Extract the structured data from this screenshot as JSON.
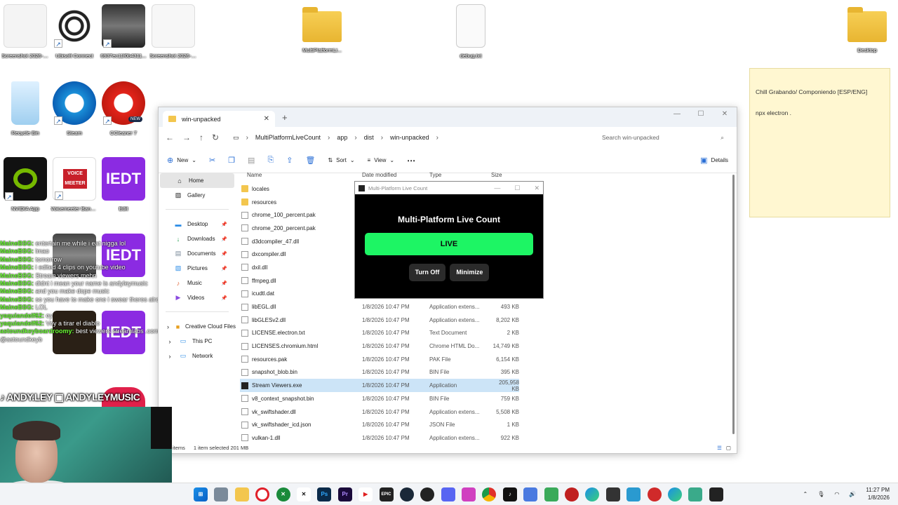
{
  "desktop": {
    "icons": [
      {
        "label": "Screenshot 2026-01 ..."
      },
      {
        "label": "Ubisoft Connect"
      },
      {
        "label": "6937ec11f0b4311..."
      },
      {
        "label": "Screenshot 2026-01 ..."
      },
      {
        "label": "MultiPlatformLi..."
      },
      {
        "label": "debug.txt"
      },
      {
        "label": "Desktop"
      },
      {
        "label": "Recycle Bin"
      },
      {
        "label": "Steam"
      },
      {
        "label": "CCleaner 7"
      },
      {
        "label": "NVIDIA App"
      },
      {
        "label": "Voicemeeter Banana"
      },
      {
        "label": "Edit"
      }
    ],
    "ieedt_text": "IEDT",
    "ccleaner_badge": "NEW",
    "voicemeeter_text": "VOICE MEETER"
  },
  "sticky_note": {
    "lines": [
      "Chill Grabando/ Componiendo [ESP/ENG]",
      "npx electron ."
    ]
  },
  "explorer": {
    "tab_title": "win-unpacked",
    "breadcrumb": [
      "MultiPlatformLiveCount",
      "app",
      "dist",
      "win-unpacked"
    ],
    "search_placeholder": "Search win-unpacked",
    "toolbar": {
      "new": "New",
      "sort": "Sort",
      "view": "View",
      "more": "⋯",
      "details": "Details"
    },
    "nav": {
      "top": [
        "Home",
        "Gallery"
      ],
      "pinned": [
        "Desktop",
        "Downloads",
        "Documents",
        "Pictures",
        "Music",
        "Videos"
      ],
      "bottom": [
        "Creative Cloud Files",
        "This PC",
        "Network"
      ]
    },
    "columns": {
      "name": "Name",
      "date": "Date modified",
      "type": "Type",
      "size": "Size"
    },
    "files": [
      {
        "name": "locales",
        "date": "",
        "type": "",
        "size": "",
        "kind": "folder"
      },
      {
        "name": "resources",
        "date": "",
        "type": "",
        "size": "",
        "kind": "folder"
      },
      {
        "name": "chrome_100_percent.pak",
        "date": "",
        "type": "",
        "size": "",
        "kind": "file"
      },
      {
        "name": "chrome_200_percent.pak",
        "date": "",
        "type": "",
        "size": "",
        "kind": "file"
      },
      {
        "name": "d3dcompiler_47.dll",
        "date": "",
        "type": "",
        "size": "",
        "kind": "file"
      },
      {
        "name": "dxcompiler.dll",
        "date": "",
        "type": "",
        "size": "",
        "kind": "file"
      },
      {
        "name": "dxil.dll",
        "date": "",
        "type": "",
        "size": "",
        "kind": "file"
      },
      {
        "name": "ffmpeg.dll",
        "date": "",
        "type": "",
        "size": "",
        "kind": "file"
      },
      {
        "name": "icudtl.dat",
        "date": "",
        "type": "",
        "size": "",
        "kind": "file"
      },
      {
        "name": "libEGL.dll",
        "date": "1/8/2026 10:47 PM",
        "type": "Application extens...",
        "size": "493 KB",
        "kind": "file"
      },
      {
        "name": "libGLESv2.dll",
        "date": "1/8/2026 10:47 PM",
        "type": "Application extens...",
        "size": "8,202 KB",
        "kind": "file"
      },
      {
        "name": "LICENSE.electron.txt",
        "date": "1/8/2026 10:47 PM",
        "type": "Text Document",
        "size": "2 KB",
        "kind": "file"
      },
      {
        "name": "LICENSES.chromium.html",
        "date": "1/8/2026 10:47 PM",
        "type": "Chrome HTML Do...",
        "size": "14,749 KB",
        "kind": "html"
      },
      {
        "name": "resources.pak",
        "date": "1/8/2026 10:47 PM",
        "type": "PAK File",
        "size": "6,154 KB",
        "kind": "file"
      },
      {
        "name": "snapshot_blob.bin",
        "date": "1/8/2026 10:47 PM",
        "type": "BIN File",
        "size": "395 KB",
        "kind": "file"
      },
      {
        "name": "Stream Viewers.exe",
        "date": "1/8/2026 10:47 PM",
        "type": "Application",
        "size": "205,958 KB",
        "kind": "exe",
        "selected": true
      },
      {
        "name": "v8_context_snapshot.bin",
        "date": "1/8/2026 10:47 PM",
        "type": "BIN File",
        "size": "759 KB",
        "kind": "file"
      },
      {
        "name": "vk_swiftshader.dll",
        "date": "1/8/2026 10:47 PM",
        "type": "Application extens...",
        "size": "5,508 KB",
        "kind": "file"
      },
      {
        "name": "vk_swiftshader_icd.json",
        "date": "1/8/2026 10:47 PM",
        "type": "JSON File",
        "size": "1 KB",
        "kind": "file"
      },
      {
        "name": "vulkan-1.dll",
        "date": "1/8/2026 10:47 PM",
        "type": "Application extens...",
        "size": "922 KB",
        "kind": "file"
      }
    ],
    "status": {
      "items": "items",
      "selected": "1 item selected  201 MB"
    }
  },
  "live_app": {
    "window_title": "Multi-Platform Live Count",
    "heading": "Multi-Platform Live Count",
    "live_label": "LIVE",
    "turn_off": "Turn Off",
    "minimize": "Minimize",
    "live_color": "#1df564"
  },
  "chat": [
    {
      "user": "MaineBSG:",
      "text": " entertain me while i eat nigga lol"
    },
    {
      "user": "MaineBSG:",
      "text": " lmao"
    },
    {
      "user": "MaineBSG:",
      "text": " tomorrow"
    },
    {
      "user": "MaineBSG:",
      "text": " i edited 4 clips on youtube video"
    },
    {
      "user": "MaineBSG:",
      "text": " Stream viewers mehn"
    },
    {
      "user": "MaineBSG:",
      "text": " didnt i mean your name is andyleymusic"
    },
    {
      "user": "MaineBSG:",
      "text": " and you make dope music"
    },
    {
      "user": "MaineBSG:",
      "text": " so you have to make one i swear theres already one out there"
    },
    {
      "user": "MaineBSG:",
      "text": " LOL"
    },
    {
      "user": "yaquiandelf62:",
      "text": " ey"
    },
    {
      "user": "yaquiandelf62:",
      "text": " Voy a tirar el diablo"
    },
    {
      "user": "astoundkeyboardroomy:",
      "text": " best viewers streamlabs .com (remove the space)"
    },
    {
      "user": "",
      "text": "@astoundkeyb"
    }
  ],
  "handles": "♪ ANDY.LEY  ▣ ANDYLEYMUSIC",
  "taskbar": {
    "apps": [
      "Ps",
      "Pr",
      "EPIC",
      "Steam",
      "Discord",
      "Chrome"
    ],
    "clock_time": "11:27 PM",
    "clock_date": "1/8/2026"
  }
}
